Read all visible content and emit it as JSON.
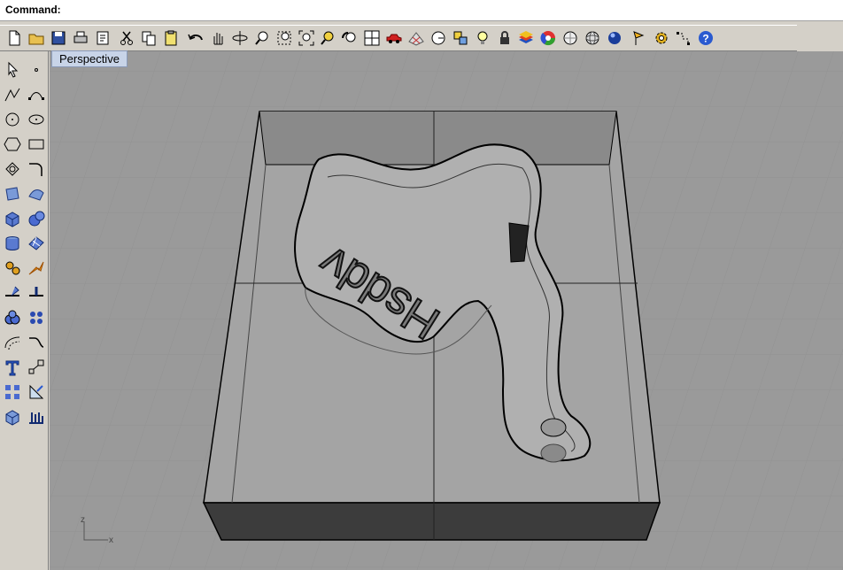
{
  "command_bar": {
    "label": "Command:",
    "value": ""
  },
  "viewport": {
    "tab_label": "Perspective",
    "engraved_text": "Hsddv",
    "axis_z": "z",
    "axis_x": "x"
  },
  "toolbar": {
    "icons": [
      "new-document",
      "open-folder",
      "save",
      "print",
      "properties",
      "cut",
      "copy",
      "paste",
      "undo",
      "pan-hand",
      "rotate-view",
      "zoom-in",
      "zoom-window",
      "zoom-extents",
      "zoom-target",
      "undo-view",
      "four-viewports",
      "car",
      "surface-grid",
      "circle-target",
      "snap",
      "light-bulb",
      "lock",
      "layer-stack",
      "color-wheel",
      "shade",
      "sphere-grid",
      "render-sphere",
      "pencil-flag",
      "gear-cog",
      "dimension",
      "help"
    ]
  },
  "leftbar": {
    "icons": [
      "select-arrow",
      "point",
      "polyline",
      "curve-point",
      "circle",
      "ellipse",
      "polygon",
      "rectangle",
      "arc",
      "fillet",
      "surface",
      "surface-patch",
      "box",
      "sphere",
      "cylinder",
      "surface-from-curve",
      "explode",
      "trim",
      "split",
      "join",
      "boolean-union",
      "array",
      "offset",
      "blend",
      "text",
      "scale",
      "transform",
      "dimension-tool",
      "block",
      "mesh"
    ]
  },
  "colors": {
    "background": "#9a9a9a",
    "grid": "#8c8c8c",
    "accent": "#3a5fbf",
    "tab": "#c8d4e8"
  }
}
